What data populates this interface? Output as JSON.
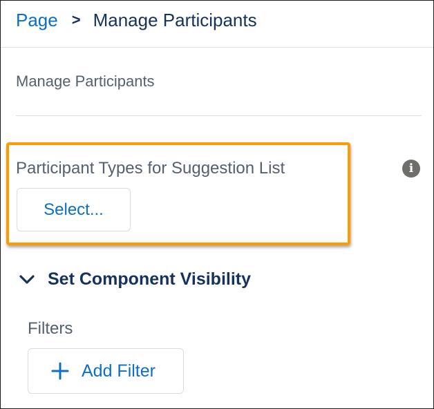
{
  "breadcrumb": {
    "root": "Page",
    "separator": ">",
    "current": "Manage Participants"
  },
  "section": {
    "title": "Manage Participants"
  },
  "participant_types": {
    "label": "Participant Types for Suggestion List",
    "button_label": "Select...",
    "info_icon": "info-icon"
  },
  "visibility": {
    "title": "Set Component Visibility",
    "expanded": true,
    "filters_label": "Filters",
    "add_filter_label": "Add Filter"
  },
  "colors": {
    "link_blue": "#0b6ec9",
    "heading_navy": "#16325c",
    "label_gray": "#54606e",
    "highlight_orange": "#ff9a00",
    "info_gray": "#706e6b"
  }
}
